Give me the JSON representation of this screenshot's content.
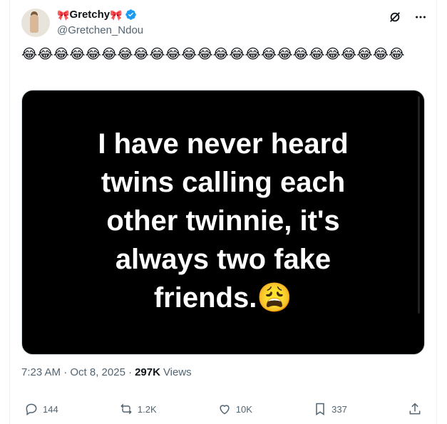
{
  "author": {
    "name": "Gretchy",
    "name_prefix": "🎀",
    "name_suffix": "🎀",
    "handle": "@Gretchen_Ndou",
    "verified_color": "#1d9bf0"
  },
  "post": {
    "text": "😂😂😂😂😂😂😂😂😂😂😂😂😂😂😂😂😂😂😂😂😂😂😂😂",
    "media_text_lines": [
      "I have never heard",
      "twins calling each",
      "other twinnie, it's",
      "always two fake",
      "friends.😩"
    ],
    "time": "7:23 AM · Oct 8, 2025 ·",
    "views_count": "297K",
    "views_label": "Views"
  },
  "actions": {
    "replies": "144",
    "reposts": "1.2K",
    "likes": "10K",
    "bookmarks": "337"
  },
  "icons": {
    "grok": "grok-icon",
    "more": "more-icon",
    "reply": "reply-icon",
    "repost": "repost-icon",
    "like": "heart-icon",
    "bookmark": "bookmark-icon",
    "share": "share-icon"
  }
}
